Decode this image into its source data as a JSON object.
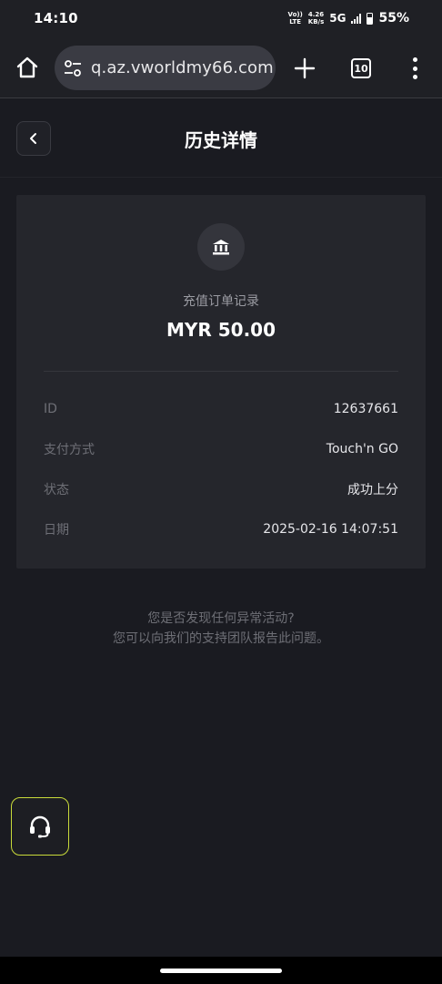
{
  "status_bar": {
    "time": "14:10",
    "volte_top": "Vo))",
    "volte_bottom": "LTE",
    "speed_top": "4.26",
    "speed_bottom": "KB/s",
    "network": "5G",
    "battery": "55%"
  },
  "browser": {
    "url": "q.az.vworldmy66.com",
    "tab_count": "10",
    "icons": [
      "home-icon",
      "tune-icon",
      "plus-icon",
      "tabs-icon",
      "more-vert-icon"
    ]
  },
  "header": {
    "title": "历史详情",
    "back_icon": "chevron-left-icon"
  },
  "card": {
    "icon": "bank-icon",
    "subtitle": "充值订单记录",
    "amount": "MYR 50.00",
    "rows": [
      {
        "label": "ID",
        "value": "12637661"
      },
      {
        "label": "支付方式",
        "value": "Touch'n GO"
      },
      {
        "label": "状态",
        "value": "成功上分"
      },
      {
        "label": "日期",
        "value": "2025-02-16 14:07:51"
      }
    ]
  },
  "notice": {
    "line1": "您是否发现任何异常活动?",
    "line2": "您可以向我们的支持团队报告此问题。"
  },
  "support": {
    "icon": "headset-icon",
    "accent": "#c9db3a"
  },
  "colors": {
    "background": "#1a1b21",
    "card": "#25262c",
    "muted_text": "#6e6f76"
  }
}
